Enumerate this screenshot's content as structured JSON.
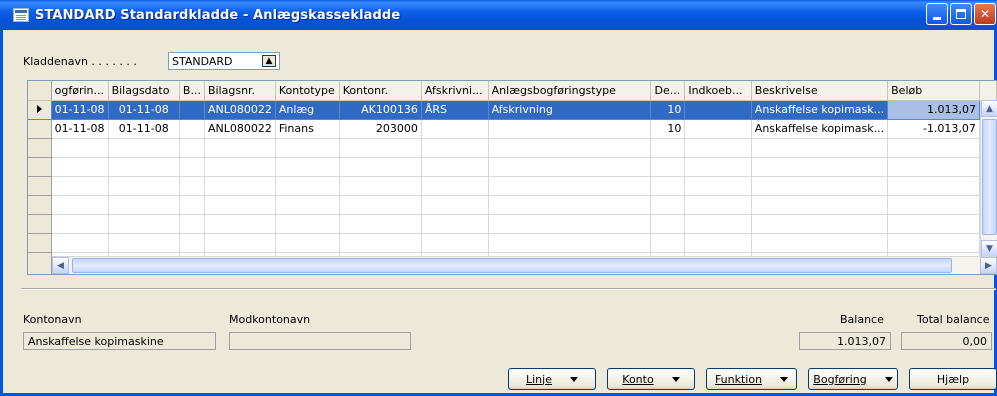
{
  "window": {
    "title": "STANDARD Standardkladde - Anlægskassekladde"
  },
  "kladde": {
    "label": "Kladdenavn . . . . . . .",
    "value": "STANDARD"
  },
  "grid": {
    "columns": [
      "ogførin...",
      "Bilagsdato",
      "B...",
      "Bilagsnr.",
      "Kontotype",
      "Kontonr.",
      "Afskrivni...",
      "Anlægsbogføringstype",
      "De...",
      "Indkoeb...",
      "Beskrivelse",
      "Beløb"
    ],
    "rows": [
      [
        "01-11-08",
        "01-11-08",
        "",
        "ANL080022",
        "Anlæg",
        "AK100136",
        "ÅRS",
        "Afskrivning",
        "10",
        "",
        "Anskaffelse kopimask...",
        "1.013,07"
      ],
      [
        "01-11-08",
        "01-11-08",
        "",
        "ANL080022",
        "Finans",
        "203000",
        "",
        "",
        "10",
        "",
        "Anskaffelse kopimask...",
        "-1.013,07"
      ]
    ],
    "empty_rows": 7
  },
  "footer": {
    "kontonavn_label": "Kontonavn",
    "kontonavn_value": "Anskaffelse kopimaskine",
    "modkontonavn_label": "Modkontonavn",
    "modkontonavn_value": "",
    "balance_label": "Balance",
    "balance_value": "1.013,07",
    "total_balance_label": "Total balance",
    "total_balance_value": "0,00"
  },
  "buttons": {
    "linje": "Linje",
    "konto": "Konto",
    "funktion": "Funktion",
    "bogforing": "Bogføring",
    "hjaelp": "Hjælp"
  }
}
